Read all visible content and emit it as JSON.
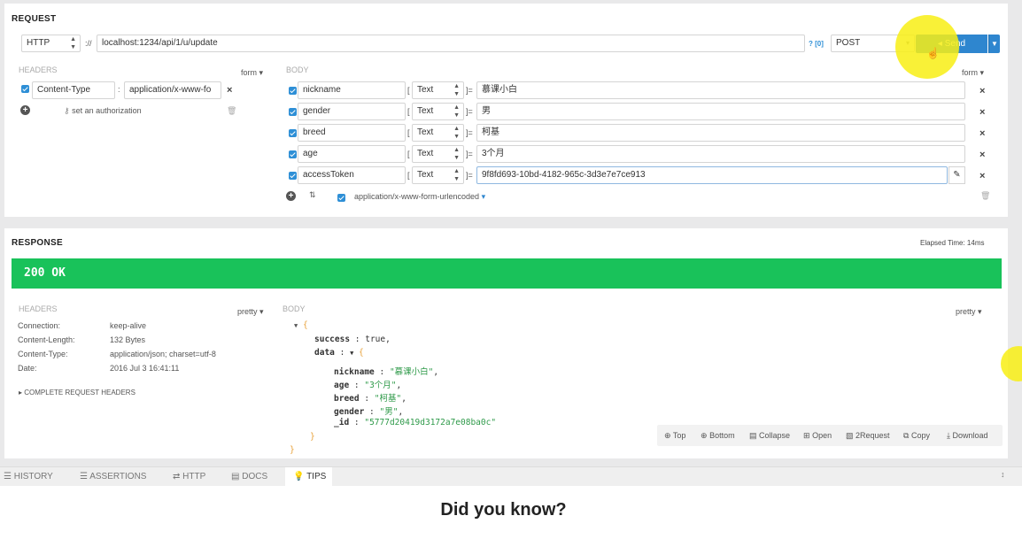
{
  "request": {
    "title": "REQUEST",
    "protocol": "HTTP",
    "separator": "://",
    "url": "localhost:1234/api/1/u/update",
    "url_help": "? [0]",
    "method": "POST",
    "send_label": "Send",
    "headers_label": "HEADERS",
    "headers_mode": "form",
    "headers": [
      {
        "name": "Content-Type",
        "value": "application/x-www-fo"
      }
    ],
    "auth_label": "set an authorization",
    "body_label": "BODY",
    "body_mode": "form",
    "body_fields": [
      {
        "name": "nickname",
        "type": "Text",
        "value": "慕课小白"
      },
      {
        "name": "gender",
        "type": "Text",
        "value": "男"
      },
      {
        "name": "breed",
        "type": "Text",
        "value": "柯基"
      },
      {
        "name": "age",
        "type": "Text",
        "value": "3个月"
      },
      {
        "name": "accessToken",
        "type": "Text",
        "value": "9f8fd693-10bd-4182-965c-3d3e7e7ce913"
      }
    ],
    "content_type": "application/x-www-form-urlencoded"
  },
  "response": {
    "title": "RESPONSE",
    "elapsed": "Elapsed Time: 14ms",
    "status": "200 OK",
    "status_color": "#19c25a",
    "headers_label": "HEADERS",
    "headers_mode": "pretty",
    "headers": [
      {
        "name": "Connection:",
        "value": "keep-alive"
      },
      {
        "name": "Content-Length:",
        "value": "132 Bytes"
      },
      {
        "name": "Content-Type:",
        "value": "application/json; charset=utf-8"
      },
      {
        "name": "Date:",
        "value": "2016 Jul 3 16:41:11"
      }
    ],
    "complete_headers": "COMPLETE REQUEST HEADERS",
    "body_label": "BODY",
    "body_mode": "pretty",
    "json_lines": {
      "open": "{",
      "success_key": "success",
      "success_val": "true",
      "data_key": "data",
      "data_open": "{",
      "nickname_key": "nickname",
      "nickname_val": "\"慕课小白\"",
      "age_key": "age",
      "age_val": "\"3个月\"",
      "breed_key": "breed",
      "breed_val": "\"柯基\"",
      "gender_key": "gender",
      "gender_val": "\"男\"",
      "id_key": "_id",
      "id_val": "\"5777d20419d3172a7e08ba0c\"",
      "data_close": "}",
      "close": "}"
    },
    "actions": [
      "Top",
      "Bottom",
      "Collapse",
      "Open",
      "2Request",
      "Copy",
      "Download"
    ]
  },
  "bottom_tabs": [
    "HISTORY",
    "ASSERTIONS",
    "HTTP",
    "DOCS",
    "TIPS"
  ],
  "tips_heading": "Did you know?"
}
